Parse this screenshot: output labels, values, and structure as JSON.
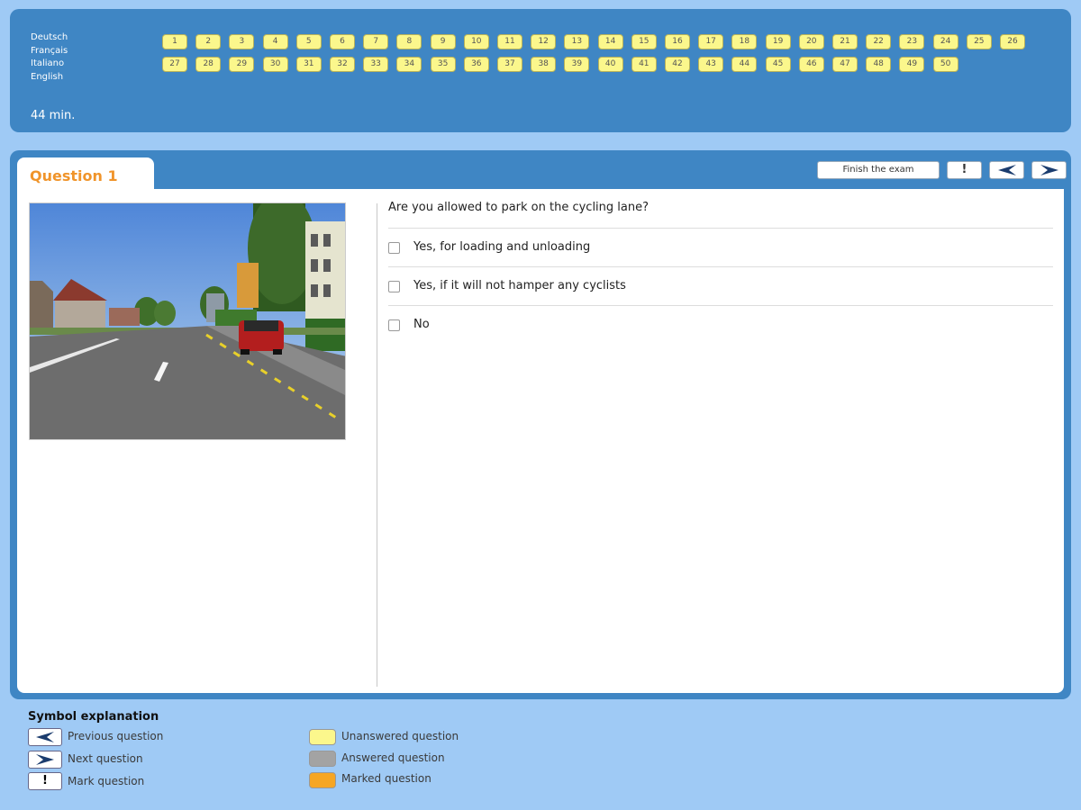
{
  "languages": [
    "Deutsch",
    "Français",
    "Italiano",
    "English"
  ],
  "timer": "44 min.",
  "question_numbers_row1": [
    "1",
    "2",
    "3",
    "4",
    "5",
    "6",
    "7",
    "8",
    "9",
    "10",
    "11",
    "12",
    "13",
    "14",
    "15",
    "16",
    "17",
    "18",
    "19",
    "20",
    "21",
    "22",
    "23",
    "24",
    "25",
    "26"
  ],
  "question_numbers_row2": [
    "27",
    "28",
    "29",
    "30",
    "31",
    "32",
    "33",
    "34",
    "35",
    "36",
    "37",
    "38",
    "39",
    "40",
    "41",
    "42",
    "43",
    "44",
    "45",
    "46",
    "47",
    "48",
    "49",
    "50"
  ],
  "question": {
    "title": "Question 1",
    "text": "Are you allowed to park on the cycling lane?",
    "answers": [
      "Yes, for loading and unloading",
      "Yes, if it will not hamper any cyclists",
      "No"
    ]
  },
  "toolbar": {
    "finish_label": "Finish the exam",
    "mark_label": "!"
  },
  "legend": {
    "title": "Symbol explanation",
    "previous": "Previous question",
    "next": "Next question",
    "mark": "Mark question",
    "unanswered": "Unanswered question",
    "answered": "Answered question",
    "marked": "Marked question",
    "mark_symbol": "!"
  },
  "colors": {
    "unanswered": "#fbf78c",
    "answered": "#a3a3a3",
    "marked": "#f6a624",
    "panel": "#3f86c4",
    "accent": "#f0942a"
  }
}
